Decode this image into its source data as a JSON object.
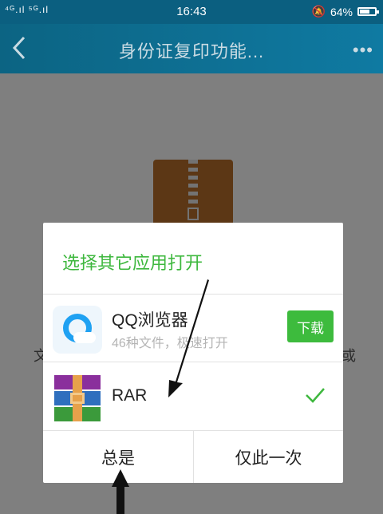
{
  "status_bar": {
    "signal": "⁴ᴳ.ıl ⁵ᴳ.ıl",
    "time": "16:43",
    "battery": "64%",
    "battery_level": 0.64
  },
  "header": {
    "title": "身份证复印功能..."
  },
  "background": {
    "left_text": "文",
    "right_text": "或"
  },
  "dialog": {
    "title": "选择其它应用打开",
    "apps": [
      {
        "name": "QQ浏览器",
        "subtitle": "46种文件，极速打开",
        "action": "下载",
        "icon": "qq-browser-icon"
      },
      {
        "name": "RAR",
        "selected": true,
        "icon": "rar-icon"
      }
    ],
    "buttons": {
      "always": "总是",
      "once": "仅此一次"
    }
  },
  "colors": {
    "accent": "#3fb83f",
    "titlebar": "#0f6a8a"
  }
}
